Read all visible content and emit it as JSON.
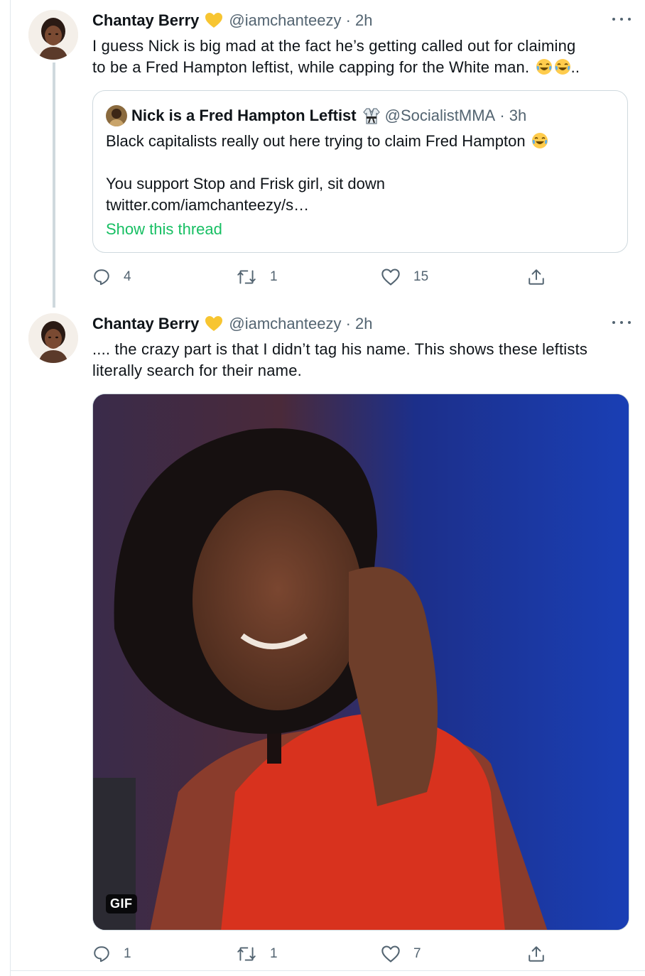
{
  "tweets": [
    {
      "display_name": "Chantay Berry",
      "verified_icon": "yellow-heart-icon",
      "handle": "@iamchanteezy",
      "separator": " · ",
      "time": "2h",
      "text_line1": "I guess Nick is big mad at the fact he’s getting called out for claiming",
      "text_line2": "to be a Fred Hampton leftist, while capping for the White man.",
      "text_tail": "..",
      "emoji": "face-with-tears-of-joy",
      "quote": {
        "display_name": "Nick is a Fred Hampton Leftist",
        "badge_icon": "martial-arts-uniform-icon",
        "handle": "@SocialistMMA",
        "separator": " · ",
        "time": "3h",
        "line1": "Black capitalists really out here trying to claim Fred Hampton",
        "line2": "You support Stop and Frisk girl, sit down",
        "line3": "twitter.com/iamchanteezy/s…",
        "show_thread": "Show this thread"
      },
      "actions": {
        "replies": "4",
        "retweets": "1",
        "likes": "15"
      }
    },
    {
      "display_name": "Chantay Berry",
      "verified_icon": "yellow-heart-icon",
      "handle": "@iamchanteezy",
      "separator": " · ",
      "time": "2h",
      "text_line1": ".... the crazy part is that I didn’t tag his name. This shows these leftists",
      "text_line2": "literally search for their name.",
      "media_badge": "GIF",
      "actions": {
        "replies": "1",
        "retweets": "1",
        "likes": "7"
      }
    }
  ],
  "colors": {
    "text": "#0f1419",
    "secondary": "#536471",
    "border": "#cfd9de",
    "thread_link": "#17bf63",
    "heart_badge": "#f7c531"
  }
}
